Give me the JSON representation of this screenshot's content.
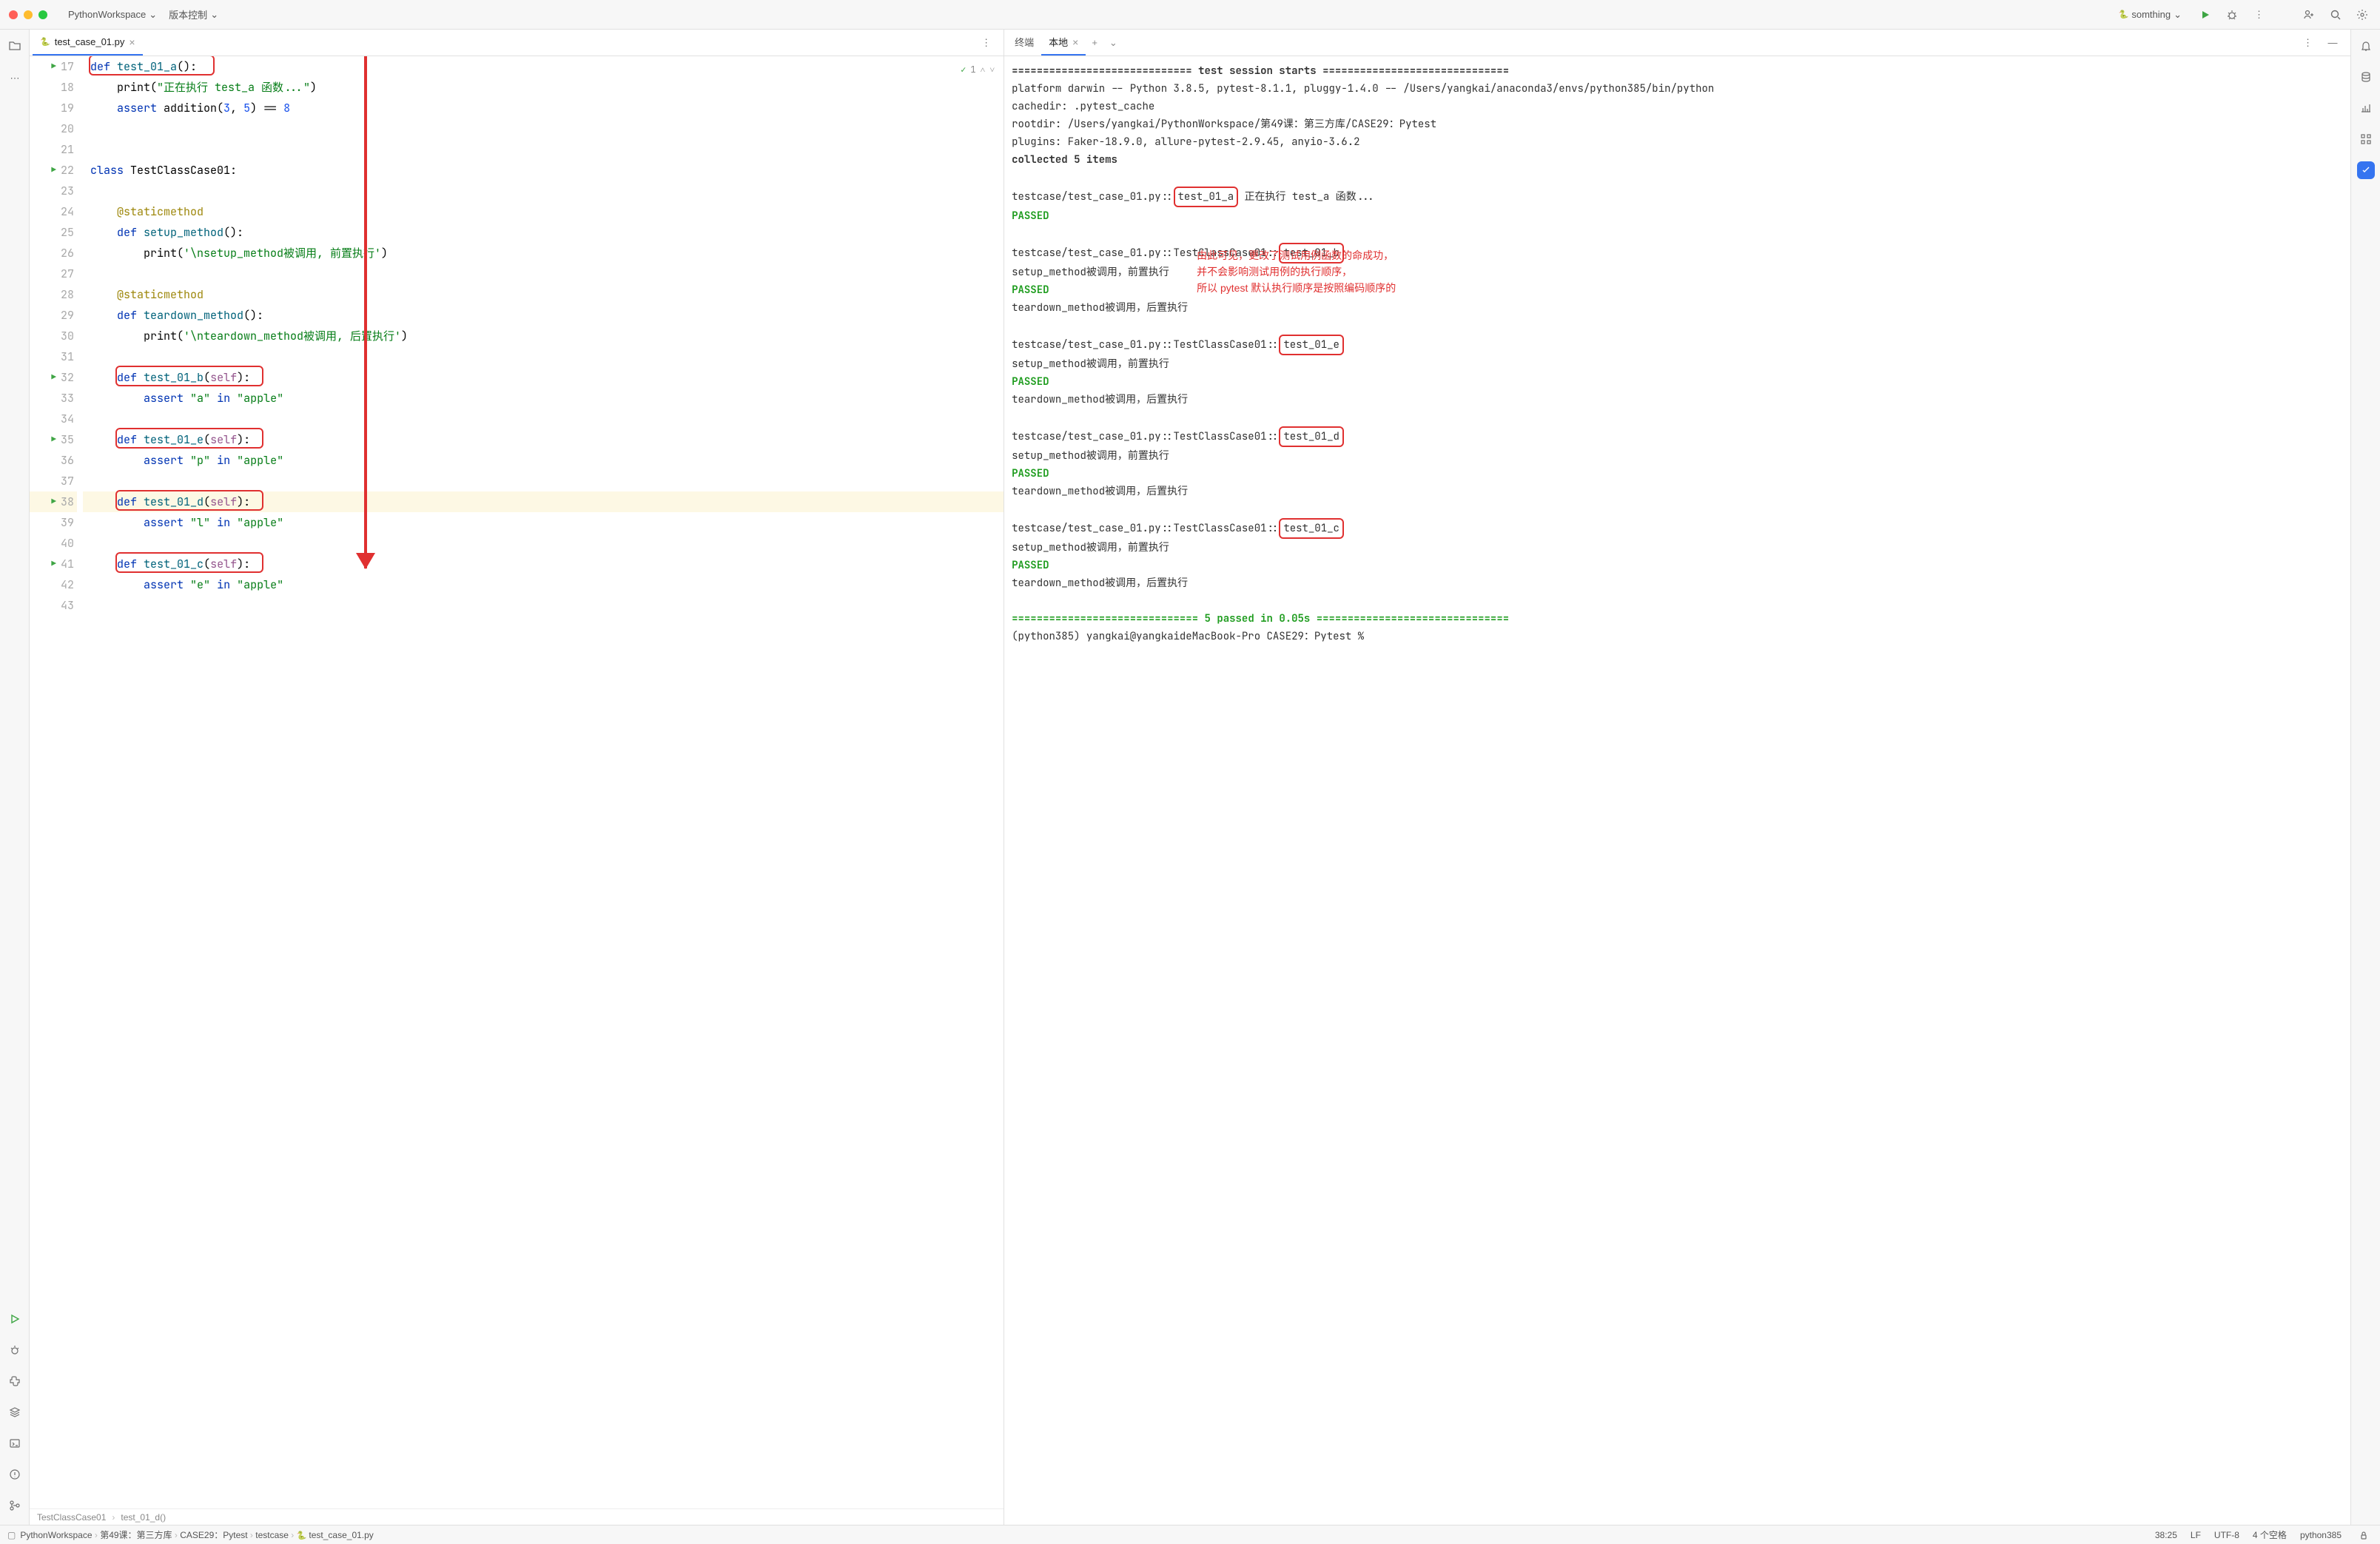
{
  "titlebar": {
    "project": "PythonWorkspace",
    "vcs": "版本控制",
    "run_config": "somthing"
  },
  "tabs": {
    "editor_file": "test_case_01.py",
    "terminal": "终端",
    "local": "本地"
  },
  "editor": {
    "inspection": "1",
    "lines": [
      {
        "n": 17,
        "run": true,
        "seg": [
          [
            "kw",
            "def "
          ],
          [
            "fn",
            "test_01_a"
          ],
          [
            "plain",
            "():"
          ]
        ],
        "box": true
      },
      {
        "n": 18,
        "seg": [
          [
            "plain",
            "    print("
          ],
          [
            "str",
            "\"正在执行 test_a 函数...\""
          ],
          [
            "plain",
            ")"
          ]
        ]
      },
      {
        "n": 19,
        "seg": [
          [
            "plain",
            "    "
          ],
          [
            "kw",
            "assert "
          ],
          [
            "plain",
            "addition("
          ],
          [
            "num",
            "3"
          ],
          [
            "plain",
            ", "
          ],
          [
            "num",
            "5"
          ],
          [
            "plain",
            ") == "
          ],
          [
            "num",
            "8"
          ]
        ]
      },
      {
        "n": 20,
        "seg": []
      },
      {
        "n": 21,
        "seg": []
      },
      {
        "n": 22,
        "run": true,
        "seg": [
          [
            "kw",
            "class "
          ],
          [
            "cls",
            "TestClassCase01"
          ],
          [
            "plain",
            ":"
          ]
        ]
      },
      {
        "n": 23,
        "seg": []
      },
      {
        "n": 24,
        "seg": [
          [
            "plain",
            "    "
          ],
          [
            "deco",
            "@staticmethod"
          ]
        ]
      },
      {
        "n": 25,
        "seg": [
          [
            "plain",
            "    "
          ],
          [
            "kw",
            "def "
          ],
          [
            "fn",
            "setup_method"
          ],
          [
            "plain",
            "():"
          ]
        ]
      },
      {
        "n": 26,
        "seg": [
          [
            "plain",
            "        print("
          ],
          [
            "str",
            "'\\nsetup_method被调用, 前置执行'"
          ],
          [
            "plain",
            ")"
          ]
        ]
      },
      {
        "n": 27,
        "seg": []
      },
      {
        "n": 28,
        "seg": [
          [
            "plain",
            "    "
          ],
          [
            "deco",
            "@staticmethod"
          ]
        ]
      },
      {
        "n": 29,
        "seg": [
          [
            "plain",
            "    "
          ],
          [
            "kw",
            "def "
          ],
          [
            "fn",
            "teardown_method"
          ],
          [
            "plain",
            "():"
          ]
        ]
      },
      {
        "n": 30,
        "seg": [
          [
            "plain",
            "        print("
          ],
          [
            "str",
            "'\\nteardown_method被调用, 后置执行'"
          ],
          [
            "plain",
            ")"
          ]
        ]
      },
      {
        "n": 31,
        "seg": []
      },
      {
        "n": 32,
        "run": true,
        "seg": [
          [
            "plain",
            "    "
          ],
          [
            "kw",
            "def "
          ],
          [
            "fn",
            "test_01_b"
          ],
          [
            "plain",
            "("
          ],
          [
            "self",
            "self"
          ],
          [
            "plain",
            "):"
          ]
        ],
        "box": true
      },
      {
        "n": 33,
        "seg": [
          [
            "plain",
            "        "
          ],
          [
            "kw",
            "assert "
          ],
          [
            "str",
            "\"a\""
          ],
          [
            "plain",
            " "
          ],
          [
            "kw",
            "in "
          ],
          [
            "str",
            "\"apple\""
          ]
        ]
      },
      {
        "n": 34,
        "seg": []
      },
      {
        "n": 35,
        "run": true,
        "seg": [
          [
            "plain",
            "    "
          ],
          [
            "kw",
            "def "
          ],
          [
            "fn",
            "test_01_e"
          ],
          [
            "plain",
            "("
          ],
          [
            "self",
            "self"
          ],
          [
            "plain",
            "):"
          ]
        ],
        "box": true
      },
      {
        "n": 36,
        "seg": [
          [
            "plain",
            "        "
          ],
          [
            "kw",
            "assert "
          ],
          [
            "str",
            "\"p\""
          ],
          [
            "plain",
            " "
          ],
          [
            "kw",
            "in "
          ],
          [
            "str",
            "\"apple\""
          ]
        ]
      },
      {
        "n": 37,
        "seg": []
      },
      {
        "n": 38,
        "run": true,
        "hl": true,
        "seg": [
          [
            "plain",
            "    "
          ],
          [
            "kw",
            "def "
          ],
          [
            "fn",
            "test_01_d"
          ],
          [
            "plain",
            "("
          ],
          [
            "self",
            "self"
          ],
          [
            "plain",
            "):"
          ]
        ],
        "box": true
      },
      {
        "n": 39,
        "seg": [
          [
            "plain",
            "        "
          ],
          [
            "kw",
            "assert "
          ],
          [
            "str",
            "\"l\""
          ],
          [
            "plain",
            " "
          ],
          [
            "kw",
            "in "
          ],
          [
            "str",
            "\"apple\""
          ]
        ]
      },
      {
        "n": 40,
        "seg": []
      },
      {
        "n": 41,
        "run": true,
        "seg": [
          [
            "plain",
            "    "
          ],
          [
            "kw",
            "def "
          ],
          [
            "fn",
            "test_01_c"
          ],
          [
            "plain",
            "("
          ],
          [
            "self",
            "self"
          ],
          [
            "plain",
            "):"
          ]
        ],
        "box": true
      },
      {
        "n": 42,
        "seg": [
          [
            "plain",
            "        "
          ],
          [
            "kw",
            "assert "
          ],
          [
            "str",
            "\"e\""
          ],
          [
            "plain",
            " "
          ],
          [
            "kw",
            "in "
          ],
          [
            "str",
            "\"apple\""
          ]
        ]
      },
      {
        "n": 43,
        "seg": []
      }
    ],
    "breadcrumb": [
      "TestClassCase01",
      "test_01_d()"
    ]
  },
  "terminal": {
    "session_header": "============================= test session starts ==============================",
    "platform": "platform darwin -- Python 3.8.5, pytest-8.1.1, pluggy-1.4.0 -- /Users/yangkai/anaconda3/envs/python385/bin/python",
    "cachedir": "cachedir: .pytest_cache",
    "rootdir": "rootdir: /Users/yangkai/PythonWorkspace/第49课：第三方库/CASE29：Pytest",
    "plugins": "plugins: Faker-18.9.0, allure-pytest-2.9.45, anyio-3.6.2",
    "collected": "collected 5 items",
    "tests": [
      {
        "path": "testcase/test_case_01.py::",
        "name": "test_01_a",
        "after": " 正在执行 test_a 函数...",
        "setup": null,
        "passed": true,
        "teardown": null
      },
      {
        "path": "testcase/test_case_01.py::TestClassCase01::",
        "name": "test_01_b",
        "after": "",
        "setup": "setup_method被调用，前置执行",
        "passed": true,
        "teardown": "teardown_method被调用，后置执行"
      },
      {
        "path": "testcase/test_case_01.py::TestClassCase01::",
        "name": "test_01_e",
        "after": "",
        "setup": "setup_method被调用，前置执行",
        "passed": true,
        "teardown": "teardown_method被调用，后置执行"
      },
      {
        "path": "testcase/test_case_01.py::TestClassCase01::",
        "name": "test_01_d",
        "after": "",
        "setup": "setup_method被调用，前置执行",
        "passed": true,
        "teardown": "teardown_method被调用，后置执行"
      },
      {
        "path": "testcase/test_case_01.py::TestClassCase01::",
        "name": "test_01_c",
        "after": "",
        "setup": "setup_method被调用，前置执行",
        "passed": true,
        "teardown": "teardown_method被调用，后置执行"
      }
    ],
    "passed_label": "PASSED",
    "footer_pre": "============================== ",
    "footer_result": "5 passed",
    "footer_time": " in 0.05s",
    "footer_post": " ===============================",
    "prompt": "(python385) yangkai@yangkaideMacBook-Pro CASE29：Pytest % ",
    "annotation": [
      "由此可见，更改了测试用例函数的命成功，",
      "并不会影响测试用例的执行顺序，",
      "所以 pytest 默认执行顺序是按照编码顺序的"
    ]
  },
  "statusbar": {
    "crumbs": [
      "PythonWorkspace",
      "第49课：第三方库",
      "CASE29：Pytest",
      "testcase",
      "test_case_01.py"
    ],
    "position": "38:25",
    "line_sep": "LF",
    "encoding": "UTF-8",
    "indent": "4 个空格",
    "interpreter": "python385"
  }
}
